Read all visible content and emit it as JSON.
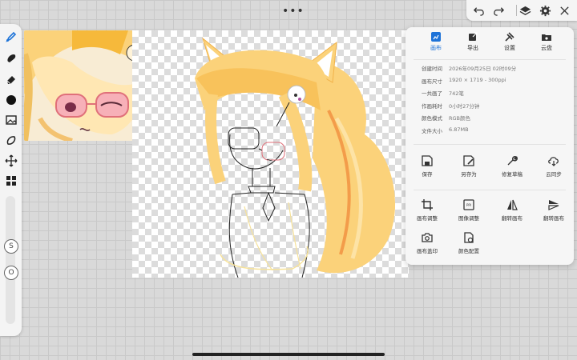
{
  "window": {
    "dots": "•••"
  },
  "tools": [
    {
      "name": "brush-tool",
      "icon": "brush-icon"
    },
    {
      "name": "smudge-tool",
      "icon": "smudge-icon"
    },
    {
      "name": "eraser-tool",
      "icon": "eraser-icon"
    },
    {
      "name": "color-picker",
      "icon": "color-dot-icon"
    },
    {
      "name": "image-tool",
      "icon": "image-icon"
    },
    {
      "name": "lasso-tool",
      "icon": "lasso-icon"
    },
    {
      "name": "transform-tool",
      "icon": "move-icon"
    },
    {
      "name": "layers-tool",
      "icon": "grid-icon"
    }
  ],
  "slider": {
    "size_badge": "S",
    "opacity_badge": "O"
  },
  "panel": {
    "tabs": [
      {
        "label": "画布",
        "icon": "canvas-icon",
        "active": true
      },
      {
        "label": "导出",
        "icon": "export-icon",
        "active": false
      },
      {
        "label": "设置",
        "icon": "settings-icon",
        "active": false
      },
      {
        "label": "云盘",
        "icon": "cloud-folder-icon",
        "active": false
      }
    ],
    "info": [
      {
        "key": "创建时间",
        "value": "2026年09月25日 02时09分"
      },
      {
        "key": "画布尺寸",
        "value": "1920 × 1719 - 300ppi"
      },
      {
        "key": "一共画了",
        "value": "742笔"
      },
      {
        "key": "作画耗时",
        "value": "0小时27分钟"
      },
      {
        "key": "颜色模式",
        "value": "RGB颜色"
      },
      {
        "key": "文件大小",
        "value": "6.87MB"
      }
    ],
    "actions_row1": [
      {
        "label": "保存",
        "icon": "save-icon"
      },
      {
        "label": "另存为",
        "icon": "save-as-icon"
      },
      {
        "label": "修复草稿",
        "icon": "wrench-icon"
      },
      {
        "label": "云同步",
        "icon": "cloud-sync-icon"
      }
    ],
    "actions_row2": [
      {
        "label": "画布调整",
        "icon": "crop-icon"
      },
      {
        "label": "图像调整",
        "icon": "image-adjust-icon"
      },
      {
        "label": "翻转画布",
        "icon": "flip-horizontal-icon"
      },
      {
        "label": "翻转画布",
        "icon": "flip-vertical-icon"
      }
    ],
    "actions_row3": [
      {
        "label": "画布盖印",
        "icon": "camera-icon"
      },
      {
        "label": "颜色配置",
        "icon": "color-config-icon"
      }
    ],
    "image_adjust_badge": "PPI"
  },
  "colors": {
    "accent": "#1e73d8",
    "hair": "#fbd27a",
    "hair_light": "#ffe6a8",
    "line": "#222222"
  }
}
